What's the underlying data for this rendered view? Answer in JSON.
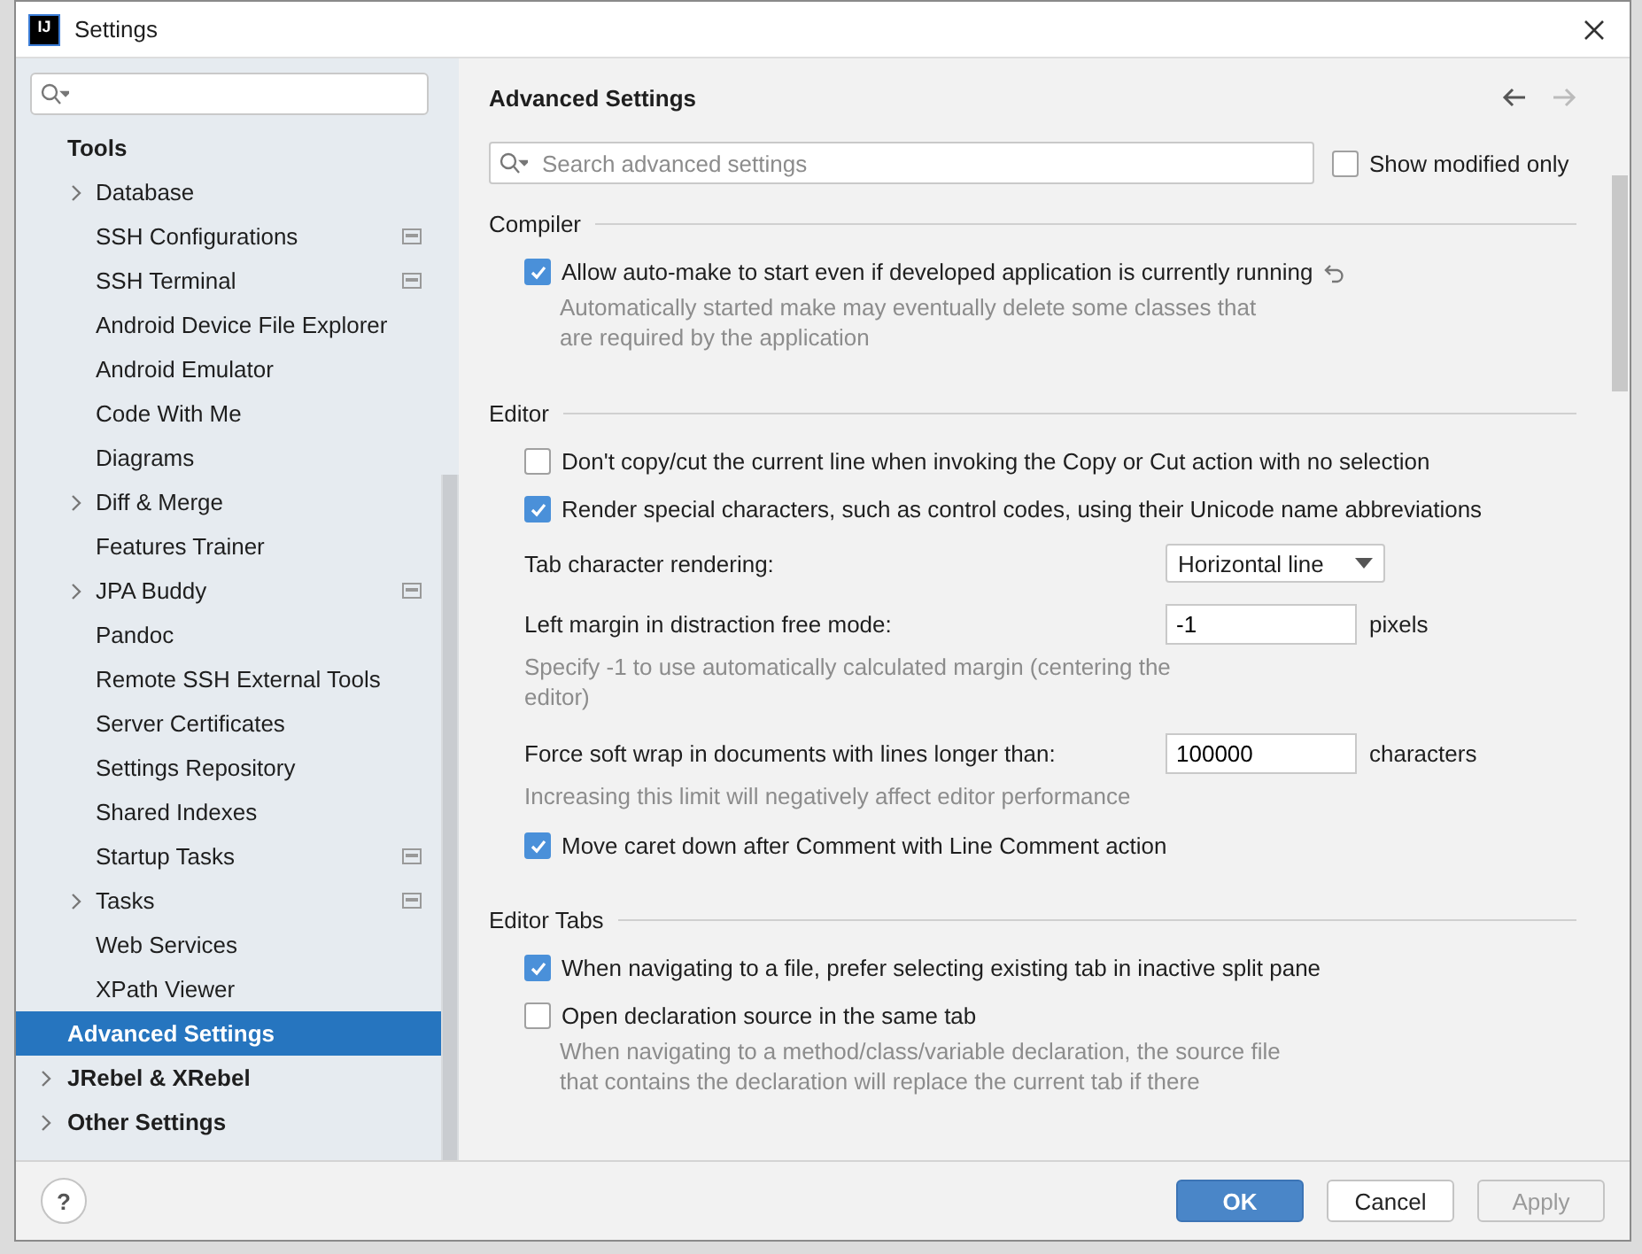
{
  "window": {
    "logo": "IJ",
    "title": "Settings"
  },
  "sidebar": {
    "items": [
      {
        "label": "Tools",
        "selected": false,
        "expandable": false,
        "project_level": false,
        "children": [
          {
            "label": "Database",
            "selected": false,
            "expandable": true,
            "project_level": false
          },
          {
            "label": "SSH Configurations",
            "selected": false,
            "expandable": false,
            "project_level": true
          },
          {
            "label": "SSH Terminal",
            "selected": false,
            "expandable": false,
            "project_level": true
          },
          {
            "label": "Android Device File Explorer",
            "selected": false,
            "expandable": false,
            "project_level": false
          },
          {
            "label": "Android Emulator",
            "selected": false,
            "expandable": false,
            "project_level": false
          },
          {
            "label": "Code With Me",
            "selected": false,
            "expandable": false,
            "project_level": false
          },
          {
            "label": "Diagrams",
            "selected": false,
            "expandable": false,
            "project_level": false
          },
          {
            "label": "Diff & Merge",
            "selected": false,
            "expandable": true,
            "project_level": false
          },
          {
            "label": "Features Trainer",
            "selected": false,
            "expandable": false,
            "project_level": false
          },
          {
            "label": "JPA Buddy",
            "selected": false,
            "expandable": true,
            "project_level": true
          },
          {
            "label": "Pandoc",
            "selected": false,
            "expandable": false,
            "project_level": false
          },
          {
            "label": "Remote SSH External Tools",
            "selected": false,
            "expandable": false,
            "project_level": false
          },
          {
            "label": "Server Certificates",
            "selected": false,
            "expandable": false,
            "project_level": false
          },
          {
            "label": "Settings Repository",
            "selected": false,
            "expandable": false,
            "project_level": false
          },
          {
            "label": "Shared Indexes",
            "selected": false,
            "expandable": false,
            "project_level": false
          },
          {
            "label": "Startup Tasks",
            "selected": false,
            "expandable": false,
            "project_level": true
          },
          {
            "label": "Tasks",
            "selected": false,
            "expandable": true,
            "project_level": true
          },
          {
            "label": "Web Services",
            "selected": false,
            "expandable": false,
            "project_level": false
          },
          {
            "label": "XPath Viewer",
            "selected": false,
            "expandable": false,
            "project_level": false
          }
        ]
      },
      {
        "label": "Advanced Settings",
        "selected": true,
        "expandable": false,
        "project_level": false
      },
      {
        "label": "JRebel & XRebel",
        "selected": false,
        "expandable": true,
        "project_level": false
      },
      {
        "label": "Other Settings",
        "selected": false,
        "expandable": true,
        "project_level": false
      }
    ]
  },
  "panel": {
    "title": "Advanced Settings",
    "nav": {
      "back_enabled": true,
      "forward_enabled": false
    },
    "search": {
      "placeholder": "Search advanced settings"
    },
    "show_modified": {
      "label": "Show modified only",
      "checked": false
    },
    "sections": [
      {
        "title": "Compiler",
        "items": [
          {
            "kind": "checkbox",
            "label": "Allow auto-make to start even if developed application is currently running",
            "checked": true,
            "modified": true,
            "hint": "Automatically started make may eventually delete some classes that are required by the application"
          }
        ]
      },
      {
        "title": "Editor",
        "items": [
          {
            "kind": "checkbox",
            "label": "Don't copy/cut the current line when invoking the Copy or Cut action with no selection",
            "checked": false,
            "modified": false
          },
          {
            "kind": "checkbox",
            "label": "Render special characters, such as control codes, using their Unicode name abbreviations",
            "checked": true,
            "modified": false
          },
          {
            "kind": "dropdown",
            "label": "Tab character rendering:",
            "value": "Horizontal line"
          },
          {
            "kind": "number",
            "label": "Left margin in distraction free mode:",
            "value": "-1",
            "unit": "pixels",
            "hint": "Specify -1 to use automatically calculated margin (centering the editor)"
          },
          {
            "kind": "number",
            "label": "Force soft wrap in documents with lines longer than:",
            "value": "100000",
            "unit": "characters",
            "hint": "Increasing this limit will negatively affect editor performance"
          },
          {
            "kind": "checkbox",
            "label": "Move caret down after Comment with Line Comment action",
            "checked": true,
            "modified": false
          }
        ]
      },
      {
        "title": "Editor Tabs",
        "items": [
          {
            "kind": "checkbox",
            "label": "When navigating to a file, prefer selecting existing tab in inactive split pane",
            "checked": true,
            "modified": false
          },
          {
            "kind": "checkbox",
            "label": "Open declaration source in the same tab",
            "checked": false,
            "modified": false,
            "hint": "When navigating to a method/class/variable declaration, the source file that contains the declaration will replace the current tab if there"
          }
        ]
      }
    ]
  },
  "footer": {
    "help": "?",
    "buttons": [
      {
        "label": "OK",
        "kind": "primary",
        "disabled": false
      },
      {
        "label": "Cancel",
        "kind": "normal",
        "disabled": false
      },
      {
        "label": "Apply",
        "kind": "normal",
        "disabled": true
      }
    ]
  }
}
